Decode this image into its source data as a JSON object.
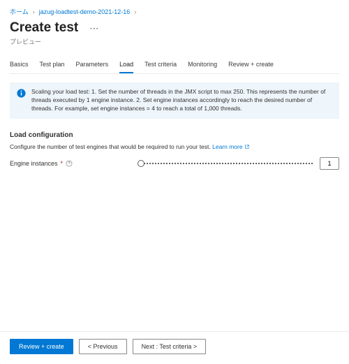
{
  "breadcrumb": {
    "home": "ホーム",
    "resource": "jazug-loadtest-demo-2021-12-16"
  },
  "title": "Create test",
  "subtitle": "プレビュー",
  "tabs": [
    {
      "label": "Basics"
    },
    {
      "label": "Test plan"
    },
    {
      "label": "Parameters"
    },
    {
      "label": "Load"
    },
    {
      "label": "Test criteria"
    },
    {
      "label": "Monitoring"
    },
    {
      "label": "Review + create"
    }
  ],
  "active_tab_index": 3,
  "info_text": "Scaling your load test: 1. Set the number of threads in the JMX script to max 250. This represents the number of threads executed by 1 engine instance. 2. Set engine instances accordingly to reach the desired number of threads. For example, set engine instances = 4 to reach a total of 1,000 threads.",
  "section": {
    "title": "Load configuration",
    "desc_prefix": "Configure the number of test engines that would be required to run your test. ",
    "learn_more": "Learn more"
  },
  "field": {
    "label": "Engine instances",
    "required": "*",
    "value": "1"
  },
  "footer": {
    "primary": "Review + create",
    "prev": "<  Previous",
    "next": "Next : Test criteria  >"
  },
  "icons": {
    "info": "info-icon",
    "help": "help-circle-icon",
    "external": "external-link-icon",
    "more": "more-icon"
  }
}
